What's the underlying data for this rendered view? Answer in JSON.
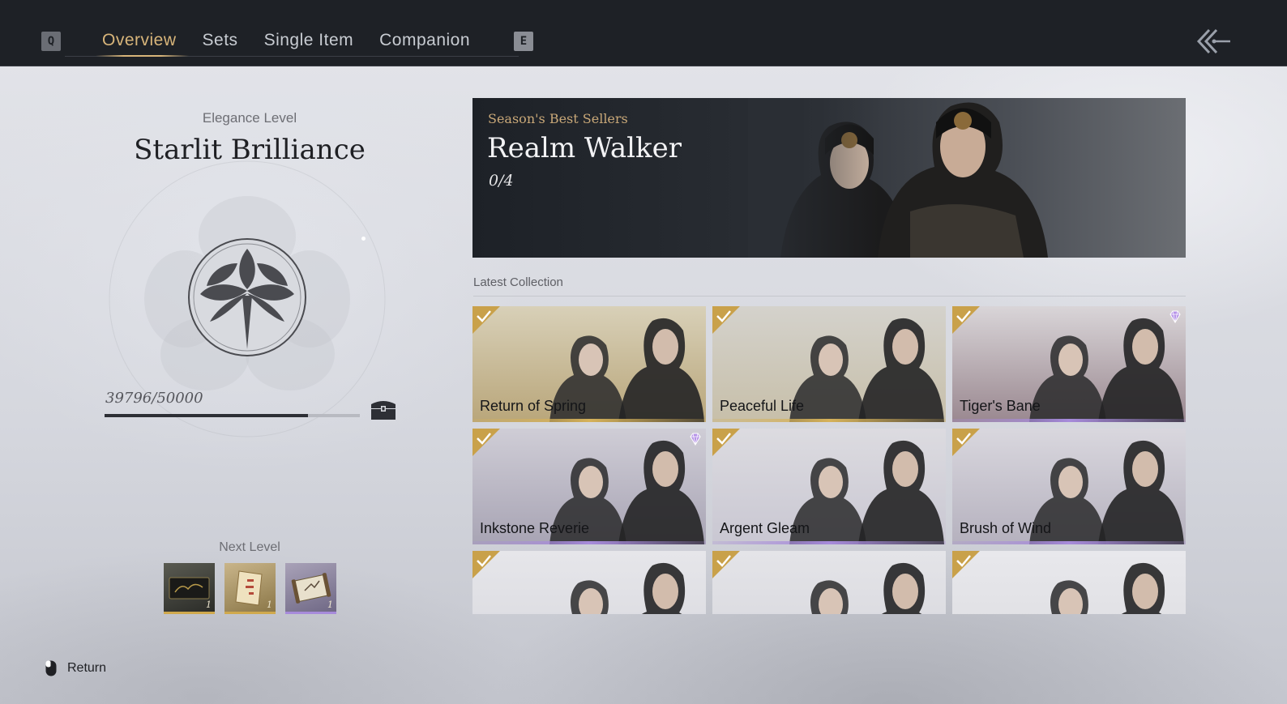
{
  "nav": {
    "left_key": "Q",
    "right_key": "E",
    "tabs": [
      {
        "label": "Overview",
        "active": true
      },
      {
        "label": "Sets",
        "active": false
      },
      {
        "label": "Single Item",
        "active": false
      },
      {
        "label": "Companion",
        "active": false
      }
    ],
    "back_icon": "back-arrow-icon"
  },
  "elegance": {
    "label": "Elegance Level",
    "title": "Starlit Brilliance",
    "progress_text": "39796/50000",
    "progress_fraction": 0.796,
    "next_level_label": "Next Level",
    "rewards": [
      {
        "qty": "1",
        "icon": "item-card-icon"
      },
      {
        "qty": "1",
        "icon": "scroll-icon"
      },
      {
        "qty": "1",
        "icon": "map-scroll-icon"
      }
    ]
  },
  "banner": {
    "subtitle": "Season's Best Sellers",
    "title": "Realm Walker",
    "count": "0/4"
  },
  "latest": {
    "label": "Latest Collection",
    "items": [
      {
        "name": "Return of Spring",
        "owned": true,
        "rare": false,
        "tone": "gold"
      },
      {
        "name": "Peaceful Life",
        "owned": true,
        "rare": false,
        "tone": "gold"
      },
      {
        "name": "Tiger's Bane",
        "owned": true,
        "rare": true,
        "tone": "purple"
      },
      {
        "name": "Inkstone Reverie",
        "owned": true,
        "rare": true,
        "tone": "purple"
      },
      {
        "name": "Argent Gleam",
        "owned": true,
        "rare": false,
        "tone": "purple"
      },
      {
        "name": "Brush of Wind",
        "owned": true,
        "rare": false,
        "tone": "purple"
      },
      {
        "name": "",
        "owned": true,
        "rare": false,
        "tone": "none"
      },
      {
        "name": "",
        "owned": true,
        "rare": false,
        "tone": "none"
      },
      {
        "name": "",
        "owned": true,
        "rare": false,
        "tone": "none"
      }
    ]
  },
  "footer": {
    "return_label": "Return",
    "return_icon": "mouse-icon"
  },
  "colors": {
    "accent_gold": "#d8b57a",
    "topbar": "#1e2126",
    "rare_purple": "#a78bdb"
  }
}
